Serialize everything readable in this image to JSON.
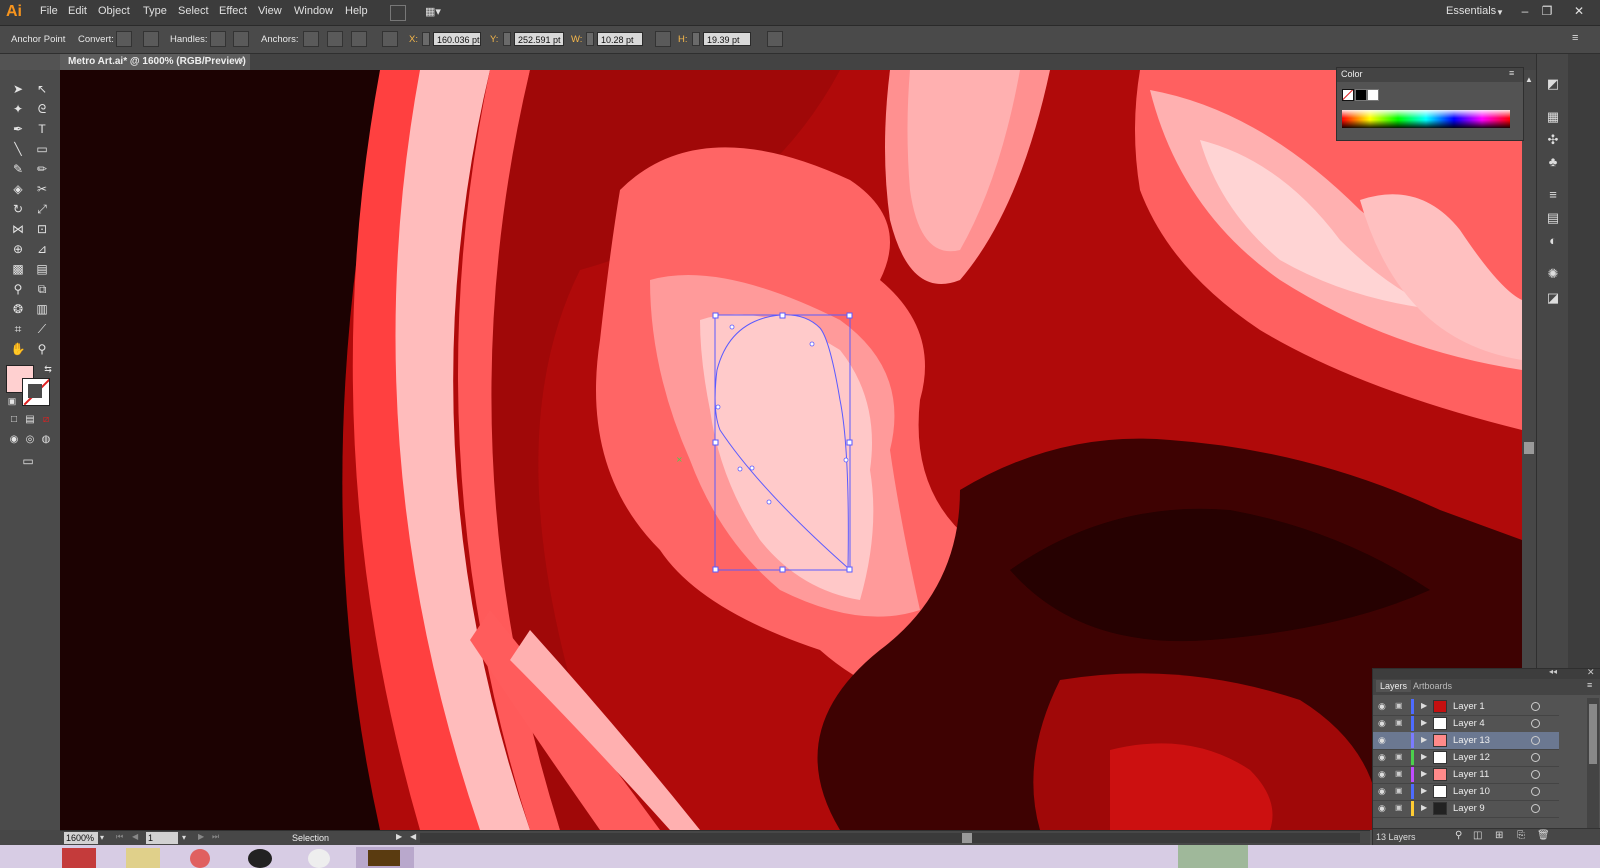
{
  "app": {
    "logo": "Ai",
    "menus": [
      "File",
      "Edit",
      "Object",
      "Type",
      "Select",
      "Effect",
      "View",
      "Window",
      "Help"
    ],
    "workspace": "Essentials"
  },
  "control_bar": {
    "tool_name": "Anchor Point",
    "convert_label": "Convert:",
    "handles_label": "Handles:",
    "anchors_label": "Anchors:",
    "x_label": "X:",
    "x_value": "160.036 pt",
    "y_label": "Y:",
    "y_value": "252.591 pt",
    "w_label": "W:",
    "w_value": "10.28 pt",
    "h_label": "H:",
    "h_value": "19.39 pt"
  },
  "document": {
    "tab_title": "Metro Art.ai* @ 1600% (RGB/Preview)",
    "close_glyph": "×"
  },
  "status_bar": {
    "zoom": "1600%",
    "artboard": "1",
    "tool_status": "Selection"
  },
  "color_panel": {
    "title": "Color"
  },
  "layers_panel": {
    "tabs": [
      "Layers",
      "Artboards"
    ],
    "layers": [
      {
        "name": "Layer 1",
        "color": "#4d6bff",
        "selected": false
      },
      {
        "name": "Layer 4",
        "color": "#4d6bff",
        "selected": false
      },
      {
        "name": "Layer 13",
        "color": "#7b7bff",
        "selected": true
      },
      {
        "name": "Layer 12",
        "color": "#4cd04c",
        "selected": false
      },
      {
        "name": "Layer 11",
        "color": "#c04cff",
        "selected": false
      },
      {
        "name": "Layer 10",
        "color": "#4d6bff",
        "selected": false
      },
      {
        "name": "Layer 9",
        "color": "#ffcc33",
        "selected": false
      }
    ],
    "count_label": "13 Layers"
  },
  "colors": {
    "fill_swatch": "#ffd0d0",
    "selection_path": "#5a5aff"
  }
}
